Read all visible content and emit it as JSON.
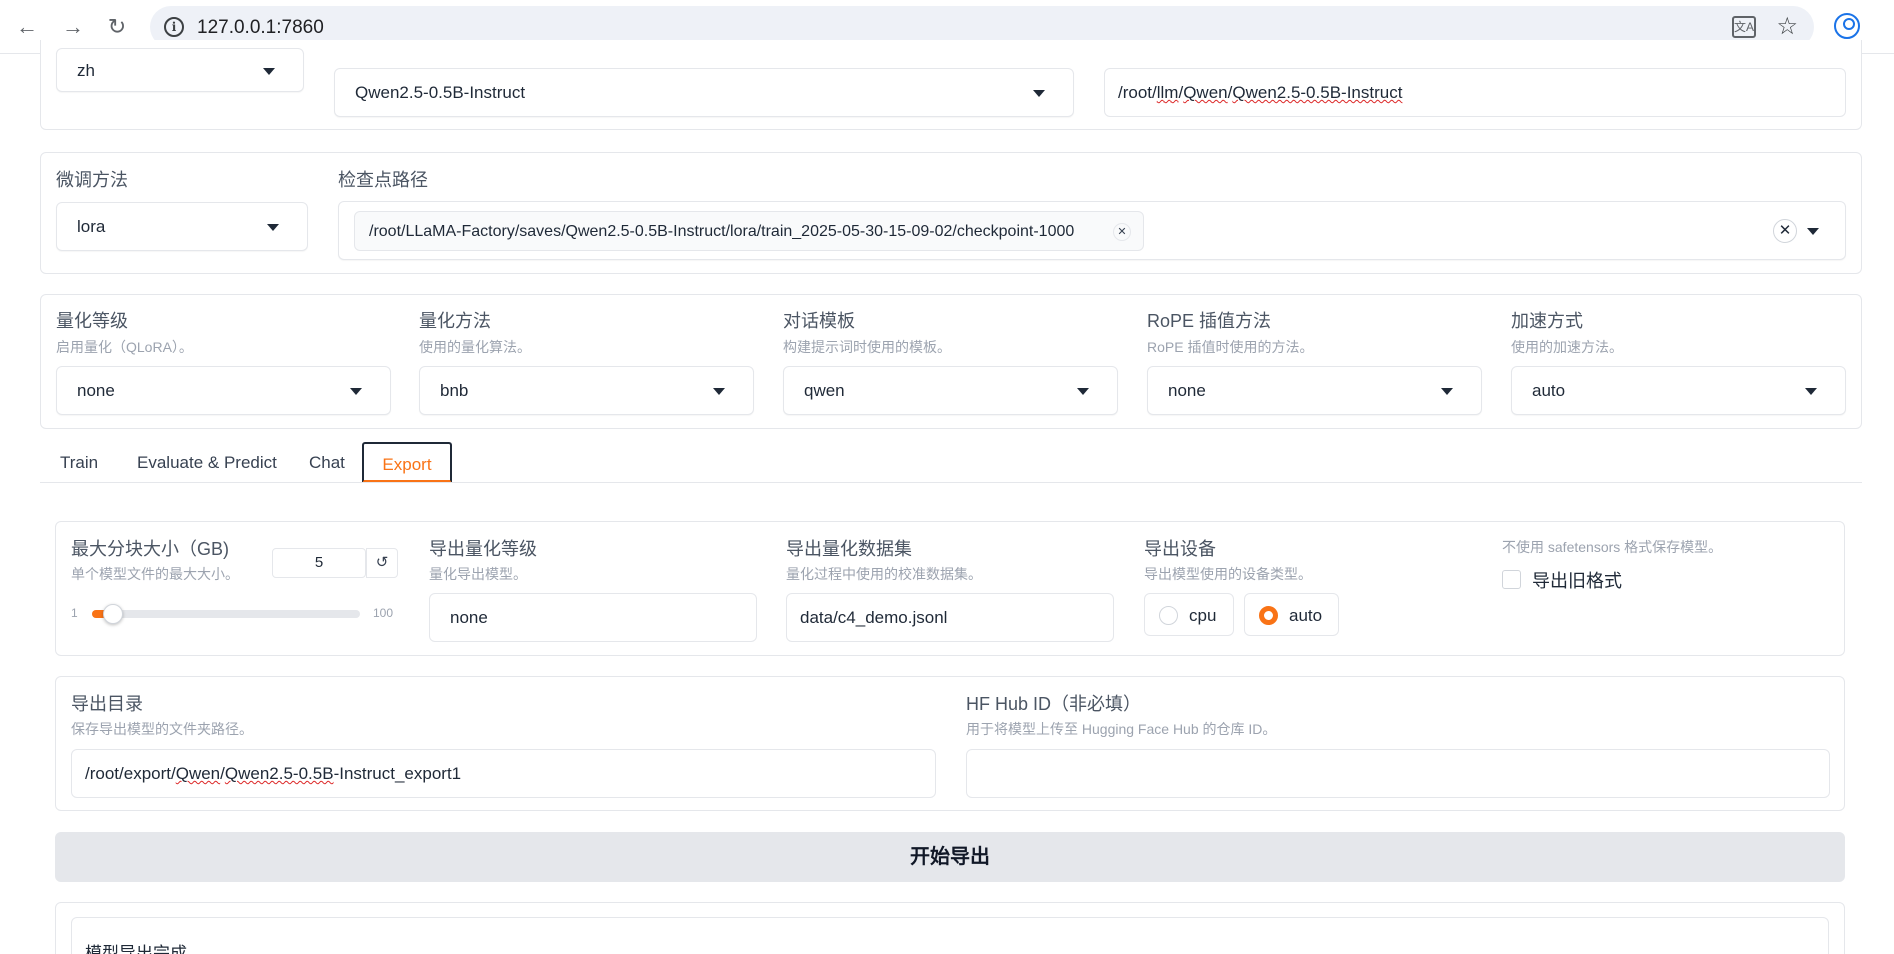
{
  "browser": {
    "url": "127.0.0.1:7860"
  },
  "top_row": {
    "lang_value": "zh",
    "model_name_value": "Qwen2.5-0.5B-Instruct",
    "model_path_prefix": "/root/",
    "model_path_segments": [
      "llm",
      "/",
      "Qwen",
      "/",
      "Qwen2.5-0.5B-Instruct"
    ]
  },
  "finetune": {
    "method_label": "微调方法",
    "method_value": "lora",
    "checkpoint_label": "检查点路径",
    "checkpoint_chip": "/root/LLaMA-Factory/saves/Qwen2.5-0.5B-Instruct/lora/train_2025-05-30-15-09-02/checkpoint-1000"
  },
  "quant_row": [
    {
      "label": "量化等级",
      "sub": "启用量化（QLoRA）。",
      "value": "none"
    },
    {
      "label": "量化方法",
      "sub": "使用的量化算法。",
      "value": "bnb"
    },
    {
      "label": "对话模板",
      "sub": "构建提示词时使用的模板。",
      "value": "qwen"
    },
    {
      "label": "RoPE 插值方法",
      "sub": "RoPE 插值时使用的方法。",
      "value": "none"
    },
    {
      "label": "加速方式",
      "sub": "使用的加速方法。",
      "value": "auto"
    }
  ],
  "tabs": [
    "Train",
    "Evaluate & Predict",
    "Chat",
    "Export"
  ],
  "export": {
    "shard_label": "最大分块大小（GB)",
    "shard_sub": "单个模型文件的最大大小。",
    "shard_value": "5",
    "reset_glyph": "↺",
    "slider_min": "1",
    "slider_max": "100",
    "slider_fraction": 0.04,
    "quant_bit_label": "导出量化等级",
    "quant_bit_sub": "量化导出模型。",
    "quant_bit_value": "none",
    "quant_dataset_label": "导出量化数据集",
    "quant_dataset_sub": "量化过程中使用的校准数据集。",
    "quant_dataset_value": "data/c4_demo.jsonl",
    "device_label": "导出设备",
    "device_sub": "导出模型使用的设备类型。",
    "device_options": [
      "cpu",
      "auto"
    ],
    "device_selected": "auto",
    "legacy_sub": "不使用 safetensors 格式保存模型。",
    "legacy_label": "导出旧格式",
    "dir_label": "导出目录",
    "dir_sub": "保存导出模型的文件夹路径。",
    "dir_value_prefix": "/root/export/",
    "dir_value_segments": [
      "Qwen",
      "/",
      "Qwen2.5-0.5B",
      "-Instruct_export1"
    ],
    "hub_label": "HF Hub ID（非必填）",
    "hub_sub": "用于将模型上传至 Hugging Face Hub 的仓库 ID。",
    "hub_value": "",
    "start_button": "开始导出",
    "output_text": "模型导出完成。"
  },
  "colors": {
    "accent": "#f97316",
    "border": "#e5e7eb"
  }
}
